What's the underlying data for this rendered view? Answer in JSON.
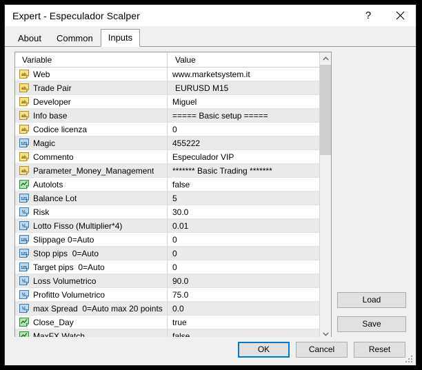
{
  "window": {
    "title": "Expert - Especulador Scalper",
    "help_button": "?",
    "close_button": "✕"
  },
  "tabs": [
    {
      "label": "About",
      "active": false
    },
    {
      "label": "Common",
      "active": false
    },
    {
      "label": "Inputs",
      "active": true
    }
  ],
  "grid": {
    "columns": [
      "Variable",
      "Value"
    ],
    "rows": [
      {
        "icon": "string-type-icon",
        "variable": "Web",
        "value": "www.marketsystem.it",
        "striped": false,
        "indent": false
      },
      {
        "icon": "string-type-icon",
        "variable": "Trade Pair",
        "value": "EURUSD M15",
        "striped": true,
        "indent": true
      },
      {
        "icon": "string-type-icon",
        "variable": "Developer",
        "value": "Miguel",
        "striped": false,
        "indent": false
      },
      {
        "icon": "string-type-icon",
        "variable": "Info base",
        "value": "===== Basic setup =====",
        "striped": true,
        "indent": false
      },
      {
        "icon": "string-type-icon",
        "variable": "Codice licenza",
        "value": "0",
        "striped": false,
        "indent": false
      },
      {
        "icon": "integer-type-icon",
        "variable": "Magic",
        "value": "455222",
        "striped": true,
        "indent": false
      },
      {
        "icon": "string-type-icon",
        "variable": "Commento",
        "value": "Especulador VIP",
        "striped": false,
        "indent": false
      },
      {
        "icon": "string-type-icon",
        "variable": "Parameter_Money_Management",
        "value": "******* Basic Trading *******",
        "striped": true,
        "indent": false
      },
      {
        "icon": "boolean-type-icon",
        "variable": "Autolots",
        "value": "false",
        "striped": false,
        "indent": false
      },
      {
        "icon": "integer-type-icon",
        "variable": "Balance Lot",
        "value": "5",
        "striped": true,
        "indent": false
      },
      {
        "icon": "double-type-icon",
        "variable": "Risk",
        "value": "30.0",
        "striped": false,
        "indent": false
      },
      {
        "icon": "double-type-icon",
        "variable": "Lotto Fisso (Multiplier*4)",
        "value": "0.01",
        "striped": true,
        "indent": false
      },
      {
        "icon": "integer-type-icon",
        "variable": "Slippage 0=Auto",
        "value": "0",
        "striped": false,
        "indent": false
      },
      {
        "icon": "integer-type-icon",
        "variable": "Stop pips  0=Auto",
        "value": "0",
        "striped": true,
        "indent": false
      },
      {
        "icon": "integer-type-icon",
        "variable": "Target pips  0=Auto",
        "value": "0",
        "striped": false,
        "indent": false
      },
      {
        "icon": "double-type-icon",
        "variable": "Loss Volumetrico",
        "value": "90.0",
        "striped": true,
        "indent": false
      },
      {
        "icon": "double-type-icon",
        "variable": "Profitto Volumetrico",
        "value": "75.0",
        "striped": false,
        "indent": false
      },
      {
        "icon": "double-type-icon",
        "variable": "max Spread  0=Auto max 20 points",
        "value": "0.0",
        "striped": true,
        "indent": false
      },
      {
        "icon": "boolean-type-icon",
        "variable": "Close_Day",
        "value": "true",
        "striped": false,
        "indent": false
      },
      {
        "icon": "boolean-type-icon",
        "variable": "MaxFX Watch",
        "value": "false",
        "striped": true,
        "indent": false
      }
    ]
  },
  "side_buttons": {
    "load": "Load",
    "save": "Save"
  },
  "bottom_buttons": {
    "ok": "OK",
    "cancel": "Cancel",
    "reset": "Reset"
  },
  "colors": {
    "accent": "#0078d7",
    "dialog_bg": "#f0f0f0",
    "stripe": "#eaeaea",
    "string_icon": "#f6d747",
    "number_icon": "#4a90d9",
    "bool_icon": "#4caf50"
  }
}
